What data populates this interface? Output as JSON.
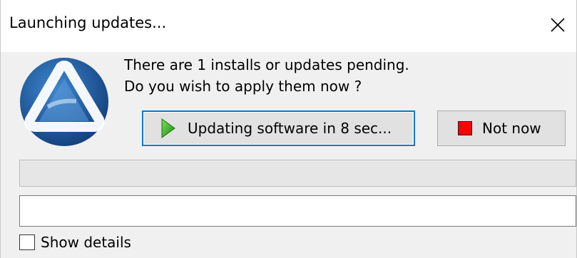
{
  "window": {
    "title": "Launching updates..."
  },
  "message": {
    "line1": "There are 1 installs or updates pending.",
    "line2": "Do you wish to apply them now ?"
  },
  "buttons": {
    "update_label": "Updating software in 8 sec...",
    "not_now_label": "Not now"
  },
  "progress": {
    "value": 0
  },
  "log_field": {
    "value": ""
  },
  "details": {
    "label": "Show details",
    "checked": false
  },
  "icons": {
    "close": "close-icon",
    "logo": "app-logo",
    "play": "play-icon",
    "stop": "stop-icon"
  },
  "colors": {
    "focus_border": "#0078d7",
    "play_green": "#38b000",
    "stop_red": "#ff0000",
    "logo_blue": "#1d5fa6"
  }
}
